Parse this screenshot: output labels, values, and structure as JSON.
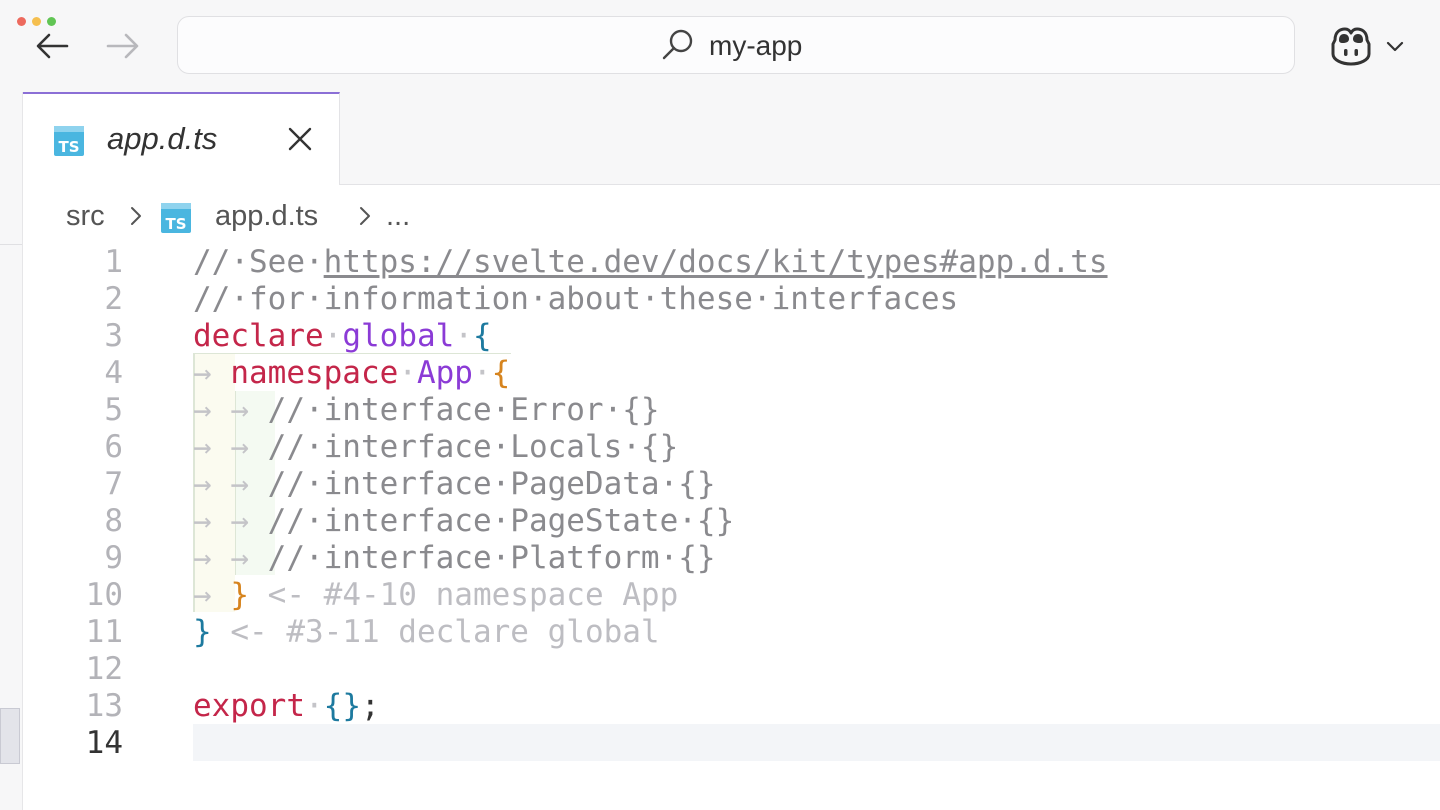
{
  "window": {
    "address": "my-app"
  },
  "icons": {
    "back": "arrow-left-icon",
    "forward": "arrow-right-icon",
    "search": "search-icon",
    "copilot": "copilot-icon",
    "dropdown": "chevron-down-icon",
    "typescript": "typescript-file-icon",
    "close": "close-icon"
  },
  "colors": {
    "accent": "#8b6fd6",
    "keyword": "#c4264a",
    "identifier": "#8b3bd6",
    "comment": "#8a8a8e"
  },
  "tab": {
    "label": "app.d.ts"
  },
  "breadcrumb": {
    "folder": "src",
    "file": "app.d.ts",
    "more": "..."
  },
  "editor": {
    "line_numbers": [
      "1",
      "2",
      "3",
      "4",
      "5",
      "6",
      "7",
      "8",
      "9",
      "10",
      "11",
      "12",
      "13",
      "14"
    ],
    "active_line": "14",
    "lines": {
      "l1_comment": "//·See·",
      "l1_link": "https://svelte.dev/docs/kit/types#app.d.ts",
      "l2_comment": "//·for·information·about·these·interfaces",
      "l3_kw": "declare",
      "l3_ws": "·",
      "l3_ident": "global",
      "l3_ws2": "·",
      "l3_brace": "{",
      "l4_tab": "→ ",
      "l4_kw": "namespace",
      "l4_ws": "·",
      "l4_ident": "App",
      "l4_ws2": "·",
      "l4_brace": "{",
      "l5_tab": "→ → ",
      "l5_comment": "//·interface·Error·{}",
      "l6_tab": "→ → ",
      "l6_comment": "//·interface·Locals·{}",
      "l7_tab": "→ → ",
      "l7_comment": "//·interface·PageData·{}",
      "l8_tab": "→ → ",
      "l8_comment": "//·interface·PageState·{}",
      "l9_tab": "→ → ",
      "l9_comment": "//·interface·Platform·{}",
      "l10_tab": "→ ",
      "l10_brace": "}",
      "l10_ghost": " <- #4-10 namespace App",
      "l11_brace": "}",
      "l11_ghost": " <- #3-11 declare global",
      "l13_kw": "export",
      "l13_ws": "·",
      "l13_brace": "{}",
      "l13_semi": ";"
    }
  }
}
